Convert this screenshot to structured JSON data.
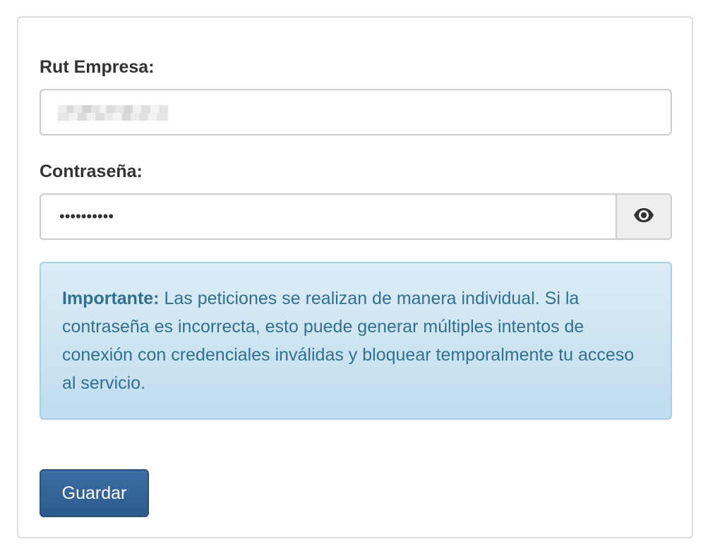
{
  "form": {
    "rut_label": "Rut Empresa:",
    "password_label": "Contraseña:",
    "password_value": "••••••••••",
    "toggle_icon": "eye-icon"
  },
  "alert": {
    "strong": "Importante:",
    "text": " Las peticiones se realizan de manera individual. Si la contraseña es incorrecta, esto puede generar múltiples intentos de conexión con credenciales inválidas y bloquear temporalmente tu acceso al servicio."
  },
  "actions": {
    "save_label": "Guardar"
  },
  "colors": {
    "alert_text": "#31708f",
    "alert_bg": "#d9edf7",
    "button_bg": "#336699"
  }
}
